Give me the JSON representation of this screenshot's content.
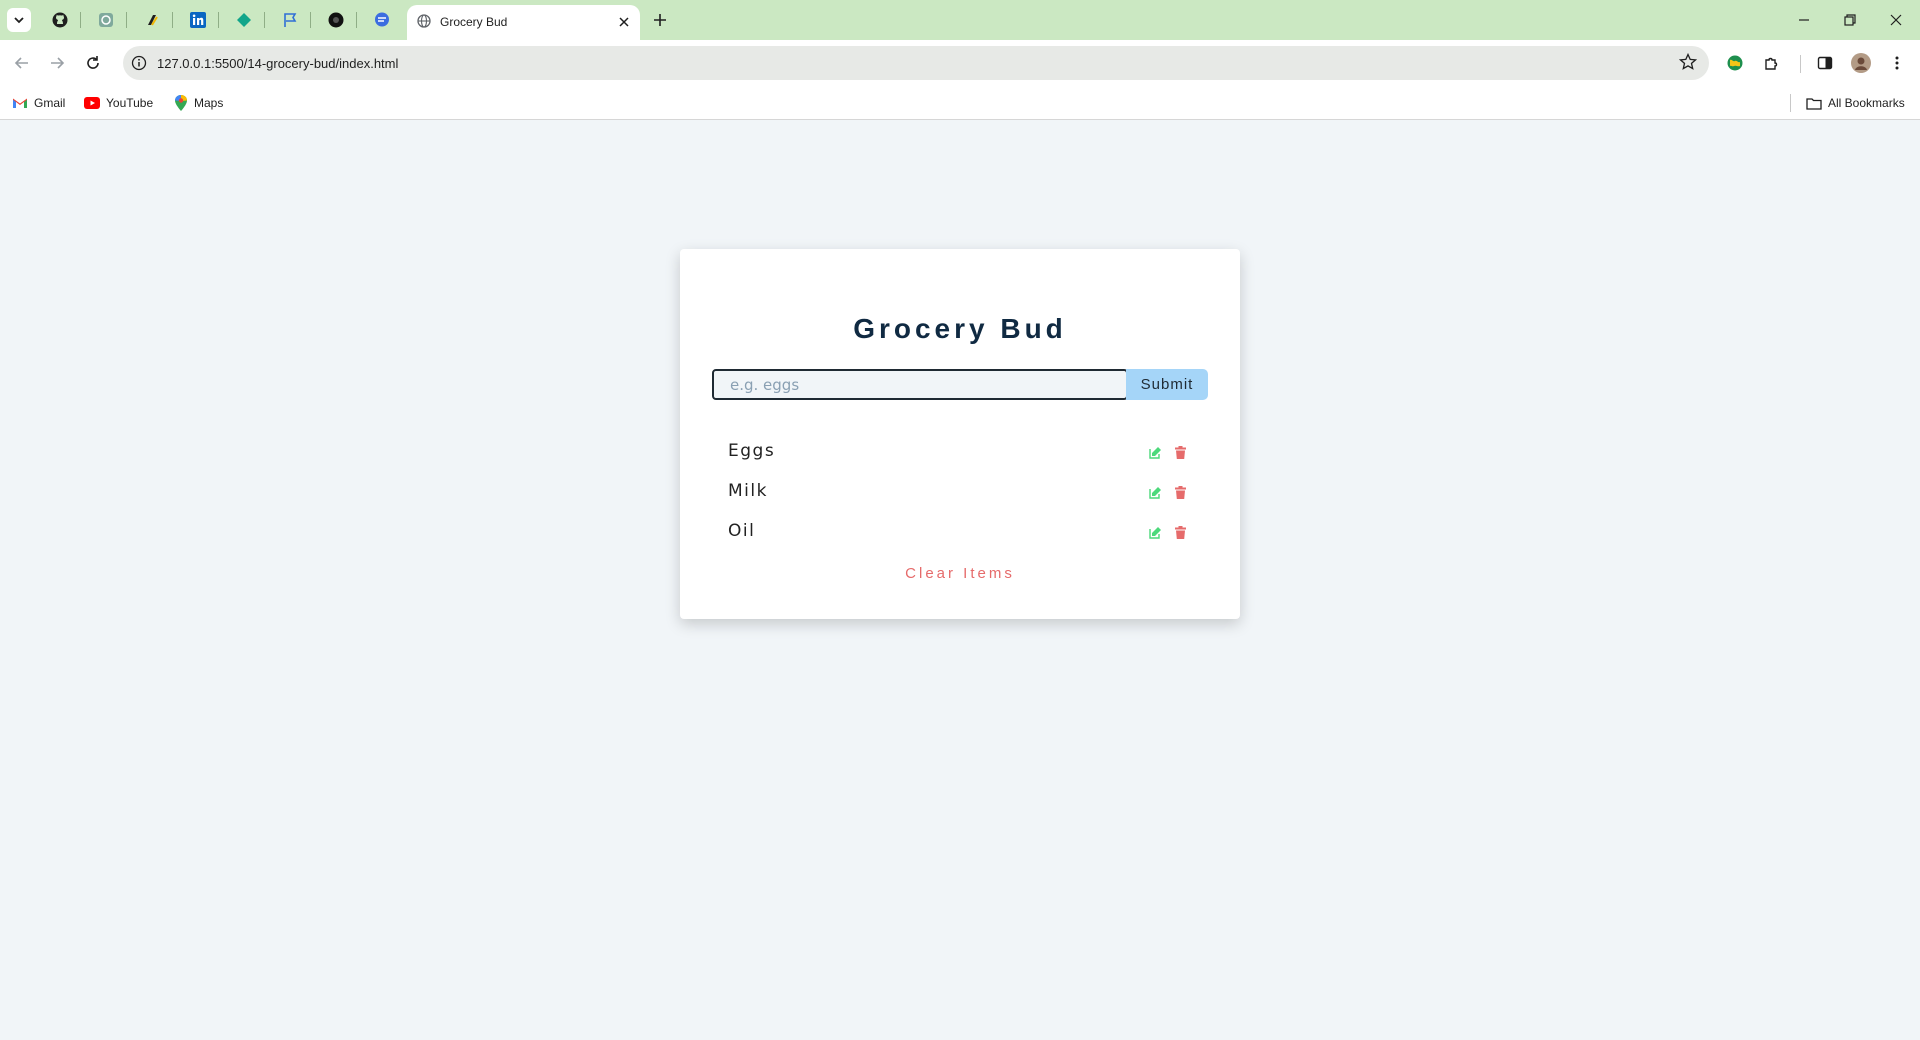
{
  "browser": {
    "active_tab": {
      "title": "Grocery Bud",
      "favicon": "globe-icon"
    },
    "pinned_tabs": [
      "github-icon",
      "openai-icon",
      "extension-icon",
      "linkedin-icon",
      "diamond-icon",
      "flag-icon",
      "circle-icon",
      "chat-icon"
    ],
    "url": "127.0.0.1:5500/14-grocery-bud/index.html",
    "bookmarks": [
      {
        "label": "Gmail",
        "icon": "gmail-icon"
      },
      {
        "label": "YouTube",
        "icon": "youtube-icon"
      },
      {
        "label": "Maps",
        "icon": "maps-icon"
      }
    ],
    "all_bookmarks_label": "All Bookmarks",
    "colors": {
      "tab_strip": "#cbe8c2",
      "omnibox": "#e7e9e6"
    }
  },
  "app": {
    "title": "Grocery Bud",
    "input": {
      "placeholder": "e.g. eggs",
      "value": ""
    },
    "submit_label": "Submit",
    "items": [
      {
        "title": "Eggs"
      },
      {
        "title": "Milk"
      },
      {
        "title": "Oil"
      }
    ],
    "clear_label": "Clear Items",
    "colors": {
      "title": "#102a42",
      "submit_bg": "#a5d5f8",
      "edit_icon": "#4cd97b",
      "delete_icon": "#e66b6b",
      "clear_text": "#e66b6b",
      "page_bg": "#f1f5f8"
    }
  }
}
